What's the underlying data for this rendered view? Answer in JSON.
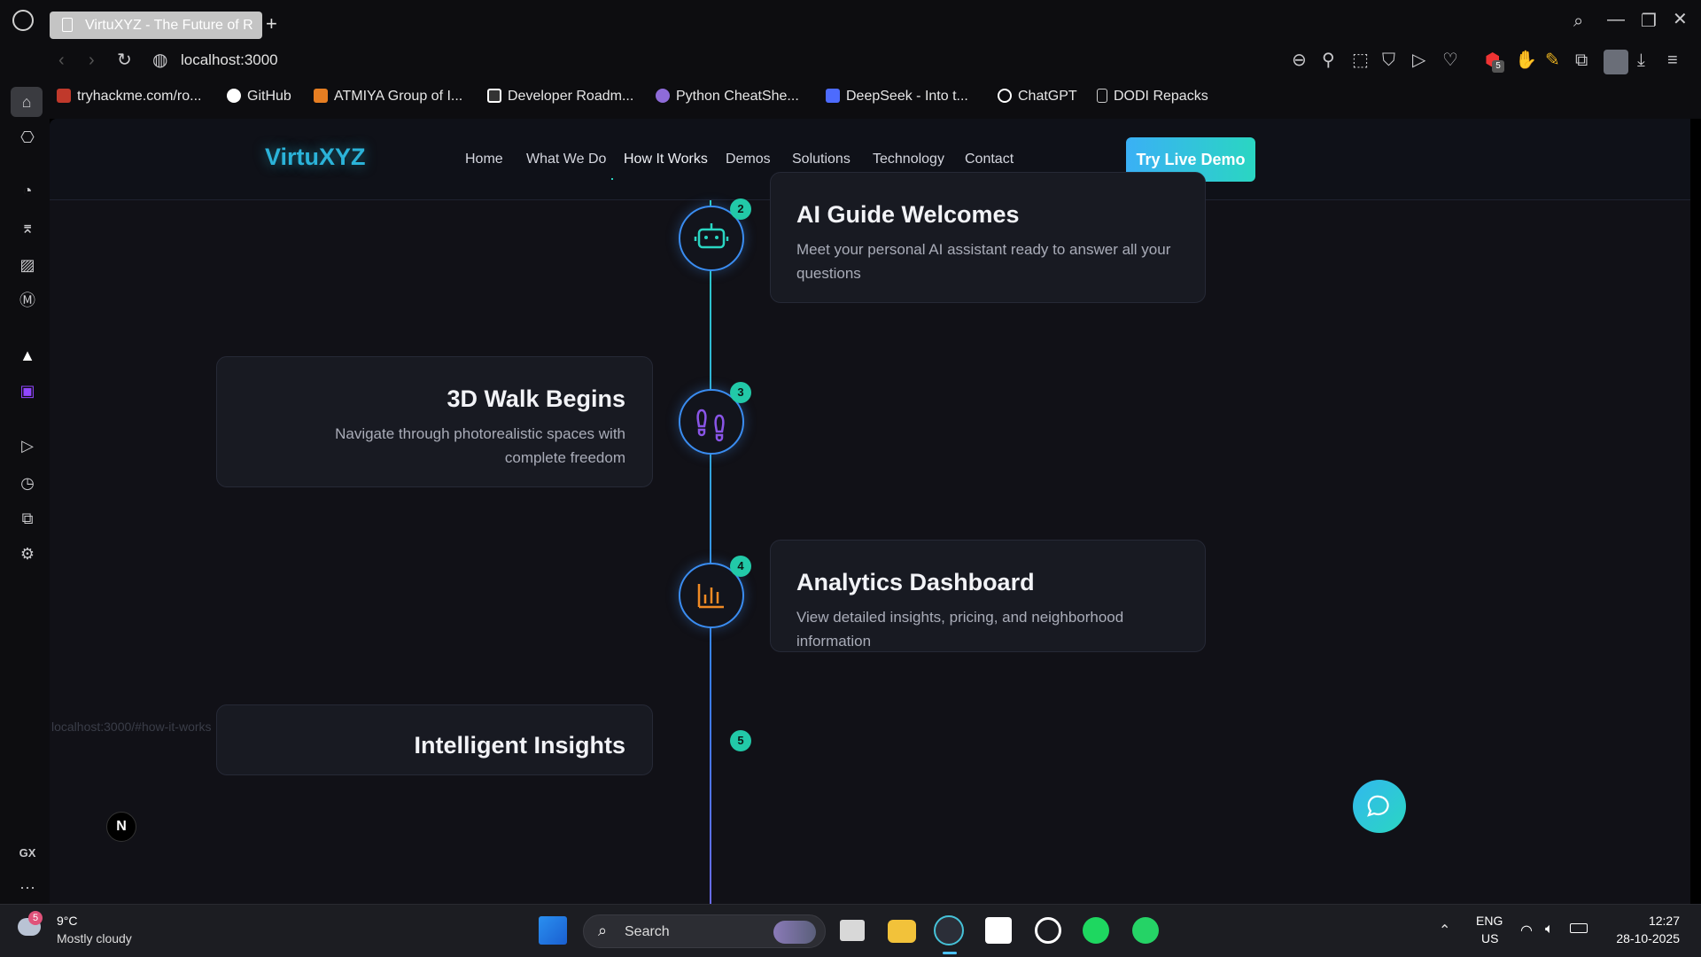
{
  "browser": {
    "tab_title": "VirtuXYZ - The Future of R",
    "new_tab": "+",
    "address": "localhost:3000",
    "bookmarks": [
      {
        "label": "tryhackme.com/ro...",
        "color": "#c0392b"
      },
      {
        "label": "GitHub",
        "color": "#ffffff"
      },
      {
        "label": "ATMIYA Group of I...",
        "color": "#e67e22"
      },
      {
        "label": "Developer Roadm...",
        "color": "#ffffff"
      },
      {
        "label": "Python CheatShe...",
        "color": "#8e6bd8"
      },
      {
        "label": "DeepSeek - Into t...",
        "color": "#4d6bfe"
      },
      {
        "label": "ChatGPT",
        "color": "#ffffff"
      },
      {
        "label": "DODI Repacks",
        "color": "#cccccc"
      }
    ],
    "extension_badge": "5",
    "status_url": "localhost:3000/#how-it-works"
  },
  "sidebar": {
    "gx_label": "GX",
    "more_label": "···"
  },
  "site": {
    "logo": "VirtuXYZ",
    "nav": [
      "Home",
      "What We Do",
      "How It Works",
      "Demos",
      "Solutions",
      "Technology",
      "Contact"
    ],
    "active_nav": "How It Works",
    "cta": "Try Live Demo",
    "accent_colors": {
      "teal": "#2ad6c2",
      "blue": "#3ab0f5",
      "badge": "#22c9a8"
    },
    "steps": [
      {
        "number": "2",
        "title": "AI Guide Welcomes",
        "description": "Meet your personal AI assistant ready to answer all your questions",
        "icon": "robot-icon",
        "side": "right"
      },
      {
        "number": "3",
        "title": "3D Walk Begins",
        "description": "Navigate through photorealistic spaces with complete freedom",
        "icon": "footprints-icon",
        "side": "left"
      },
      {
        "number": "4",
        "title": "Analytics Dashboard",
        "description": "View detailed insights, pricing, and neighborhood information",
        "icon": "bar-chart-icon",
        "side": "right"
      },
      {
        "number": "5",
        "title": "Intelligent Insights",
        "side": "left"
      }
    ],
    "next_badge": "N"
  },
  "taskbar": {
    "weather_temp": "9°C",
    "weather_desc": "Mostly cloudy",
    "weather_badge": "5",
    "search_label": "Search",
    "lang_line1": "ENG",
    "lang_line2": "US",
    "time": "12:27",
    "date": "28-10-2025"
  }
}
